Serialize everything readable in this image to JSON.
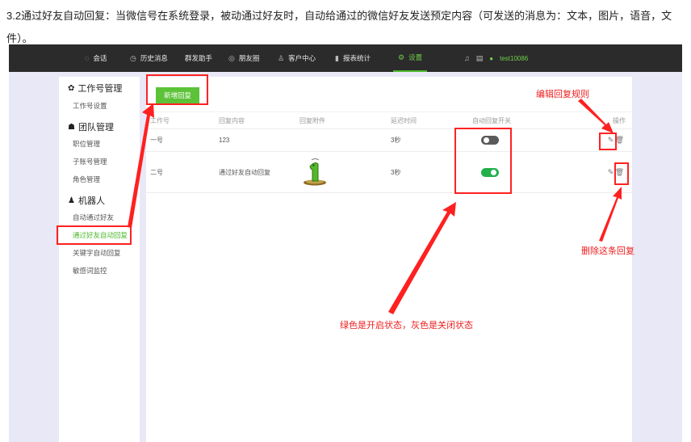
{
  "intro_text": "3.2通过好友自动回复：当微信号在系统登录，被动通过好友时，自动给通过的微信好友发送预定内容（可发送的消息为：文本，图片，语音，文件）。",
  "nav": {
    "items": [
      {
        "label": "会话",
        "icon": "chat-icon"
      },
      {
        "label": "历史消息",
        "icon": "clock-icon"
      },
      {
        "label": "群发助手",
        "icon": ""
      },
      {
        "label": "朋友圈",
        "icon": "moments-icon"
      },
      {
        "label": "客户中心",
        "icon": "person-icon"
      },
      {
        "label": "报表统计",
        "icon": "bar-chart-icon"
      },
      {
        "label": "设置",
        "icon": "gear-icon",
        "active": true
      }
    ],
    "user_name": "test10086",
    "accent_color": "#4cb82a"
  },
  "sidebar": {
    "groups": [
      {
        "title": "工作号管理",
        "icon": "wechat-icon",
        "items": [
          "工作号设置"
        ]
      },
      {
        "title": "团队管理",
        "icon": "team-icon",
        "items": [
          "职位管理",
          "子账号管理",
          "角色管理"
        ]
      },
      {
        "title": "机器人",
        "icon": "robot-icon",
        "items": [
          "自动通过好友",
          "通过好友自动回复",
          "关键字自动回复",
          "敏感词监控"
        ]
      }
    ],
    "active_item": "通过好友自动回复"
  },
  "content": {
    "add_button_label": "新增回复",
    "columns": [
      "工作号",
      "回复内容",
      "回复附件",
      "延迟时间",
      "自动回复开关",
      "操作"
    ],
    "rows": [
      {
        "account": "一号",
        "content": "123",
        "attachment": "",
        "delay": "3秒",
        "auto_reply_on": false
      },
      {
        "account": "二号",
        "content": "通过好友自动回复",
        "attachment": "image",
        "delay": "3秒",
        "auto_reply_on": true
      }
    ]
  },
  "annotations": {
    "edit_label": "编辑回复规则",
    "delete_label": "删除这条回复",
    "toggle_label": "绿色是开启状态，灰色是关闭状态",
    "color": "#ff2222"
  }
}
